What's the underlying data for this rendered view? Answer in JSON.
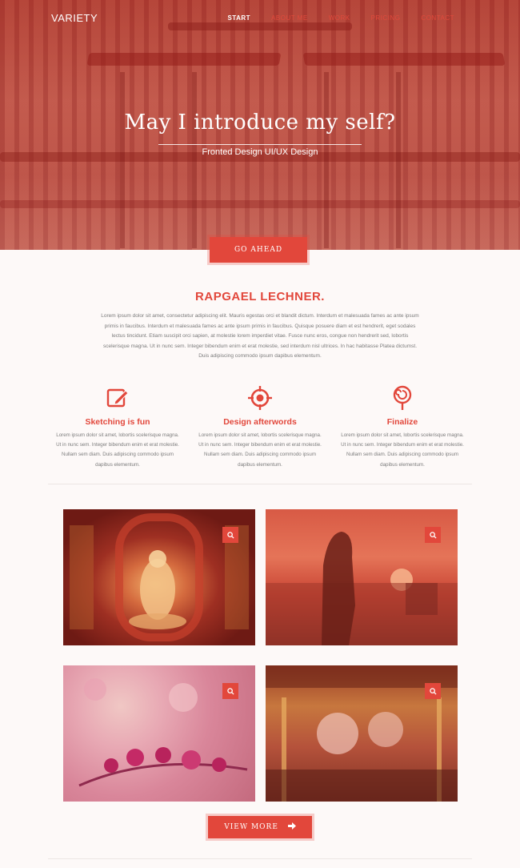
{
  "header": {
    "logo": "VARIETY",
    "nav": [
      {
        "label": "START",
        "active": true
      },
      {
        "label": "ABOUT ME",
        "active": false
      },
      {
        "label": "WORK",
        "active": false
      },
      {
        "label": "PRICING",
        "active": false
      },
      {
        "label": "CONTACT",
        "active": false
      }
    ]
  },
  "hero": {
    "title": "May I introduce my self?",
    "subtitle": "Fronted Design UI/UX Design",
    "button": "GO AHEAD"
  },
  "about": {
    "name": "RAPGAEL LECHNER.",
    "text": "Lorem ipsum dolor sit amet, consectetur adipiscing elit. Mauris egestas orci et blandit dictum. Interdum et malesuada fames ac ante ipsum primis in faucibus. Interdum et malesuada fames ac ante ipsum primis in faucibus. Quisque posuere diam et est hendrerit, eget sodales lectus tincidunt. Etiam suscipit orci sapien, at molestie lorem imperdiet vitae. Fusce nunc eros, congue non hendrerit sed, lobortis scelerisque magna. Ut in nunc sem. Integer bibendum enim et erat molestie, sed interdum nisl ultrices. In hac habitasse Platea dictumst. Duis adipiscing commodo ipsum dapibus elementum."
  },
  "features": [
    {
      "icon": "pencil-edit-icon",
      "title": "Sketching is fun",
      "text": "Lorem ipsum dolor sit amet, lobortis scelerisque magna. Ut in nunc sem. Integer bibendum enim et erat molestie. Nullam sem diam. Duis adipiscing commodo ipsum dapibus elementum."
    },
    {
      "icon": "target-crosshair-icon",
      "title": "Design afterwords",
      "text": "Lorem ipsum dolor sit amet, lobortis scelerisque magna. Ut in nunc sem. Integer bibendum enim et erat molestie. Nullam sem diam. Duis adipiscing commodo ipsum dapibus elementum."
    },
    {
      "icon": "lollipop-icon",
      "title": "Finalize",
      "text": "Lorem ipsum dolor sit amet, lobortis scelerisque magna. Ut in nunc sem. Integer bibendum enim et erat molestie. Nullam sem diam. Duis adipiscing commodo ipsum dapibus elementum."
    }
  ],
  "gallery": {
    "button": "VIEW MORE",
    "zoom_icon": "search-icon"
  },
  "colors": {
    "accent": "#e2473b"
  }
}
